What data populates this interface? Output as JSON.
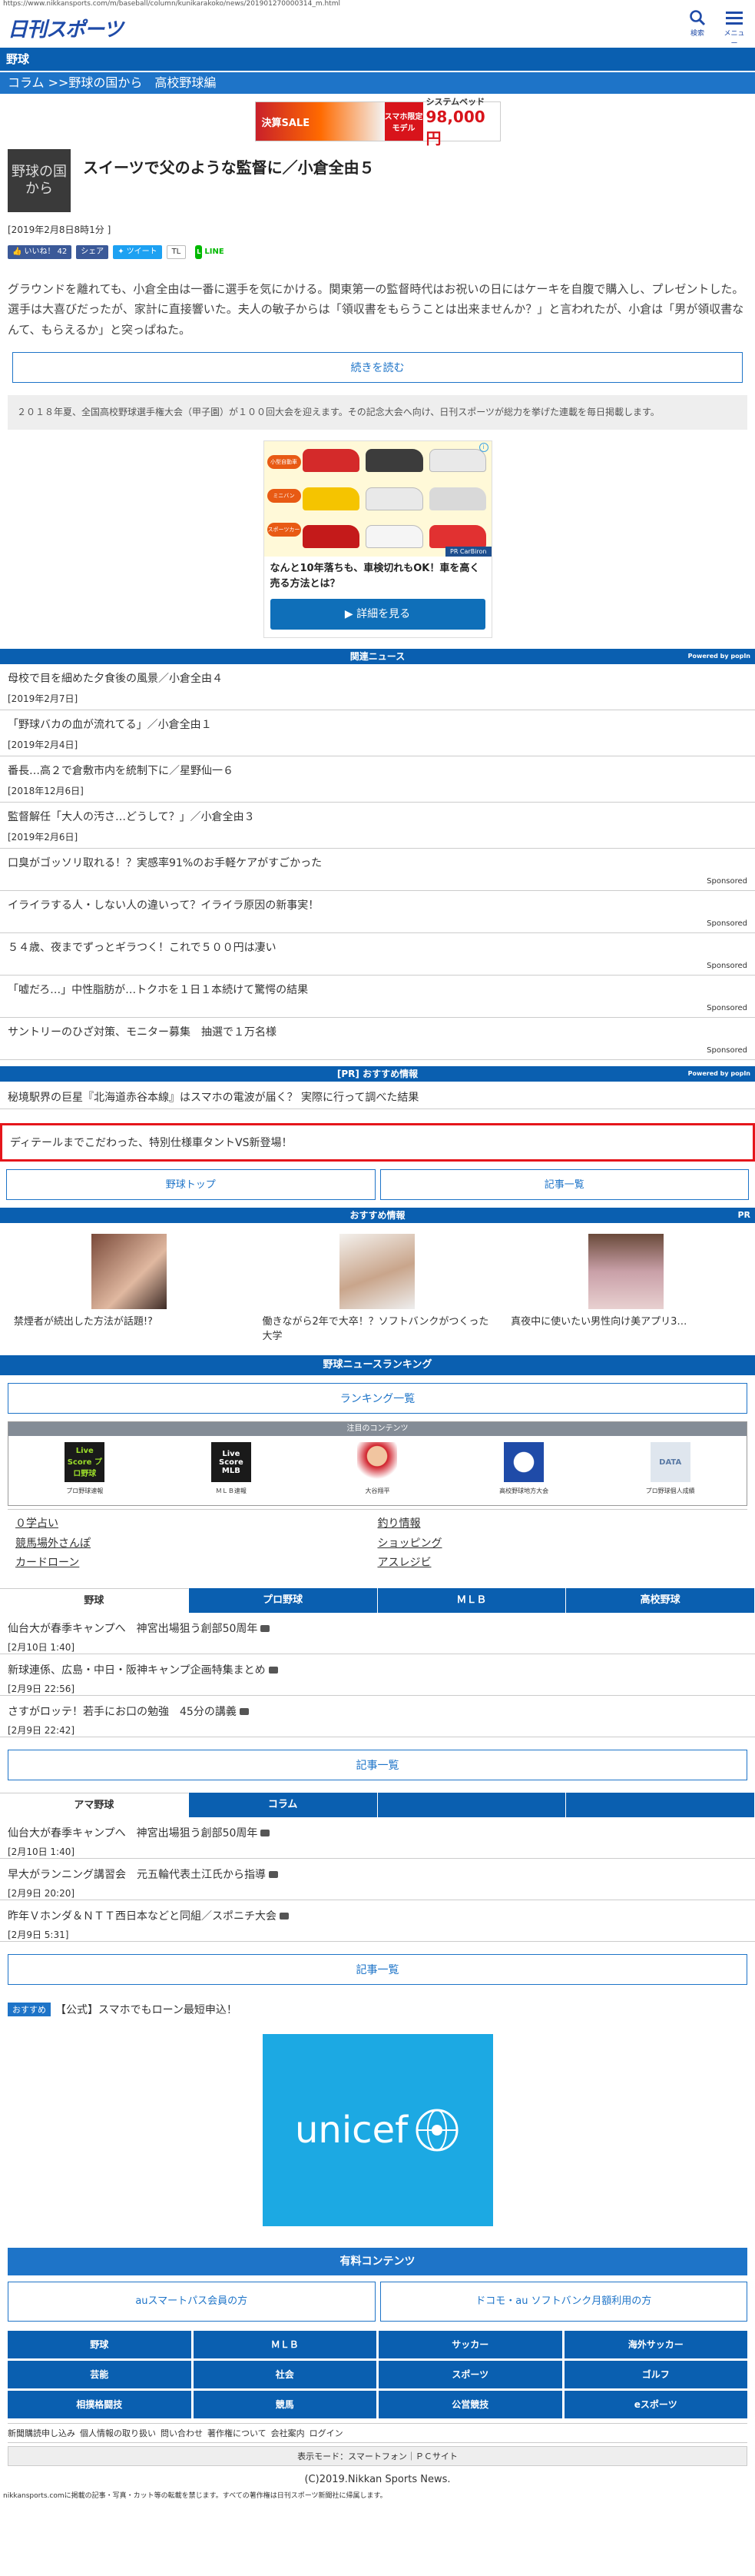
{
  "url": "https://www.nikkansports.com/m/baseball/column/kunikarakoko/news/201901270000314_m.html",
  "header": {
    "logo": "日刊スポーツ",
    "search_label": "検索",
    "menu_label": "メニュー"
  },
  "section": "野球",
  "breadcrumb": "コラム >>野球の国から　高校野球編",
  "banner": {
    "left": "決算SALE",
    "mid": "スマホ限定モデル",
    "right_top": "システムベッド",
    "right_price": "98,000円"
  },
  "article": {
    "thumb_text": "野球の国から",
    "title": "スイーツで父のような監督に／小倉全由５",
    "date": "[2019年2月8日8時1分 ]",
    "social": {
      "like": "いいね！",
      "like_count": "42",
      "share": "シェア",
      "tweet": "ツイート",
      "tl": "TL",
      "line": "LINE"
    },
    "lead": "グラウンドを離れても、小倉全由は一番に選手を気にかける。関東第一の監督時代はお祝いの日にはケーキを自腹で購入し、プレゼントした。選手は大喜びだったが、家計に直接響いた。夫人の敏子からは「領収書をもらうことは出来ませんか？」と言われたが、小倉は「男が領収書なんて、もらえるか」と突っぱねた。",
    "read_more": "続きを読む",
    "note": "２０１８年夏、全国高校野球選手権大会（甲子園）が１００回大会を迎えます。その記念大会へ向け、日刊スポーツが総力を挙げた連載を毎日掲載します。"
  },
  "ad_card": {
    "labels": [
      "小型自動車",
      "ミニバン",
      "スポーツカー"
    ],
    "brand": "PR CarBiron",
    "text": "なんと10年落ちも、車検切れもOK！車を高く売る方法とは？",
    "cta": "▶ 詳細を見る"
  },
  "related": {
    "title": "関連ニュース",
    "powered": "Powered by popIn",
    "items": [
      {
        "title": "母校で目を細めた夕食後の風景／小倉全由４",
        "date": "[2019年2月7日]"
      },
      {
        "title": "「野球バカの血が流れてる」／小倉全由１",
        "date": "[2019年2月4日]"
      },
      {
        "title": "番長…高２で倉敷市内を統制下に／星野仙一６",
        "date": "[2018年12月6日]"
      },
      {
        "title": "監督解任「大人の汚さ…どうして？」／小倉全由３",
        "date": "[2019年2月6日]"
      }
    ],
    "sponsored": [
      {
        "title": "口臭がゴッソリ取れる！？実感率91%のお手軽ケアがすごかった",
        "tag": "Sponsored"
      },
      {
        "title": "イライラする人・しない人の違いって？イライラ原因の新事実！",
        "tag": "Sponsored"
      },
      {
        "title": "５４歳、夜までずっとギラつく！これで５００円は凄い",
        "tag": "Sponsored"
      },
      {
        "title": "「嘘だろ…」中性脂肪が…トクホを１日１本続けて驚愕の結果",
        "tag": "Sponsored"
      },
      {
        "title": "サントリーのひざ対策、モニター募集　抽選で１万名様",
        "tag": "Sponsored"
      }
    ]
  },
  "pr": {
    "title": "[PR] おすすめ情報",
    "powered": "Powered by popIn",
    "items": [
      "秘境駅界の巨星『北海道赤谷本線』はスマホの電波が届く？ 実際に行って調べた結果"
    ]
  },
  "red_box": "ディテールまでこだわった、特別仕様車タントVS新登場！",
  "nav_buttons": [
    "野球トップ",
    "記事一覧"
  ],
  "recommend": {
    "title": "おすすめ情報",
    "pr": "PR",
    "items": [
      "禁煙者が続出した方法が話題!?",
      "働きながら2年で大卒！？ソフトバンクがつくった大学",
      "真夜中に使いたい男性向け美アプリ3…"
    ]
  },
  "ranking": {
    "title": "野球ニュースランキング",
    "button": "ランキング一覧"
  },
  "focus": {
    "title": "注目のコンテンツ",
    "items": [
      {
        "icon": "Live Score プロ野球",
        "label": "プロ野球速報"
      },
      {
        "icon": "Live Score MLB",
        "label": "ＭＬＢ速報"
      },
      {
        "icon": "",
        "label": "大谷翔平"
      },
      {
        "icon": "",
        "label": "高校野球地方大会"
      },
      {
        "icon": "DATA",
        "label": "プロ野球個人成績"
      }
    ],
    "links": [
      "０学占い",
      "釣り情報",
      "競馬場外さんぽ",
      "ショッピング",
      "カードローン",
      "アスレジビ"
    ]
  },
  "tabs1": {
    "labels": [
      "野球",
      "プロ野球",
      "ＭＬＢ",
      "高校野球"
    ],
    "items": [
      {
        "title": "仙台大が春季キャンプへ　神宮出場狙う創部50周年",
        "date": "[2月10日 1:40]"
      },
      {
        "title": "新球連係、広島・中日・阪神キャンプ企画特集まとめ",
        "date": "[2月9日 22:56]"
      },
      {
        "title": "さすがロッテ！若手にお口の勉強　45分の講義",
        "date": "[2月9日 22:42]"
      }
    ],
    "more": "記事一覧"
  },
  "tabs2": {
    "labels": [
      "アマ野球",
      "コラム",
      "",
      ""
    ],
    "items": [
      {
        "title": "仙台大が春季キャンプへ　神宮出場狙う創部50周年",
        "date": "[2月10日 1:40]"
      },
      {
        "title": "早大がランニング講習会　元五輪代表土江氏から指導",
        "date": "[2月9日 20:20]"
      },
      {
        "title": "昨年Ｖホンダ＆ＮＴＴ西日本などと同組／スポニチ大会",
        "date": "[2月9日 5:31]"
      }
    ],
    "more": "記事一覧"
  },
  "promo": {
    "tag": "おすすめ",
    "text": "【公式】スマホでもローン最短申込！"
  },
  "unicef": "unicef",
  "paid": {
    "title": "有料コンテンツ",
    "buttons": [
      "auスマートパス会員の方",
      "ドコモ・au ソフトバンク月額利用の方"
    ]
  },
  "categories": [
    "野球",
    "ＭＬＢ",
    "サッカー",
    "海外サッカー",
    "芸能",
    "社会",
    "スポーツ",
    "ゴルフ",
    "相撲格闘技",
    "競馬",
    "公営競技",
    "eスポーツ"
  ],
  "footer_links": [
    "新聞購読申し込み",
    "個人情報の取り扱い",
    "問い合わせ",
    "著作権について",
    "会社案内",
    "ログイン"
  ],
  "display_mode": "表示モード：スマートフォン｜ＰＣサイト",
  "copyright": "(C)2019.Nikkan Sports News.",
  "legal": "nikkansports.comに掲載の記事・写真・カット等の転載を禁じます。すべての著作権は日刊スポーツ新聞社に帰属します。"
}
